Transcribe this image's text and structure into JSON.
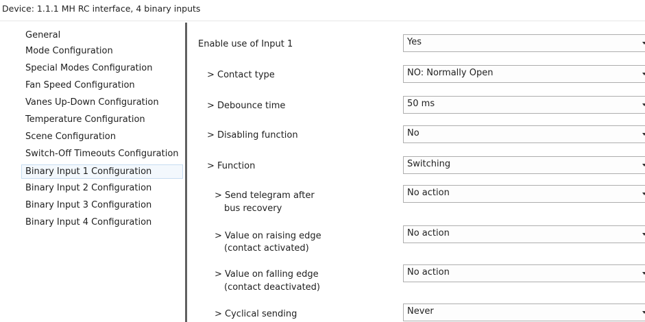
{
  "window": {
    "title": "Device: 1.1.1  MH RC interface, 4 binary inputs"
  },
  "sidebar": {
    "items": [
      {
        "label": "General"
      },
      {
        "label": "Mode Configuration"
      },
      {
        "label": "Special Modes Configuration"
      },
      {
        "label": "Fan Speed Configuration"
      },
      {
        "label": "Vanes Up-Down Configuration"
      },
      {
        "label": "Temperature Configuration"
      },
      {
        "label": "Scene Configuration"
      },
      {
        "label": "Switch-Off Timeouts Configuration"
      },
      {
        "label": "Binary Input 1 Configuration"
      },
      {
        "label": "Binary Input 2 Configuration"
      },
      {
        "label": "Binary Input 3 Configuration"
      },
      {
        "label": "Binary Input 4 Configuration"
      }
    ],
    "selected": "Binary Input 1 Configuration"
  },
  "params": [
    {
      "label": "Enable use of Input 1",
      "value": "Yes"
    },
    {
      "label": "> Contact type",
      "value": "NO: Normally Open"
    },
    {
      "label": "> Debounce time",
      "value": "50 ms"
    },
    {
      "label": "> Disabling function",
      "value": "No"
    },
    {
      "label": "> Function",
      "value": "Switching"
    },
    {
      "label": "> Send telegram after",
      "label2": "bus recovery",
      "value": "No action"
    },
    {
      "label": "> Value on raising edge",
      "label2": "(contact activated)",
      "value": "No action"
    },
    {
      "label": "> Value on falling edge",
      "label2": "(contact deactivated)",
      "value": "No action"
    },
    {
      "label": "> Cyclical sending",
      "value": "Never"
    }
  ]
}
